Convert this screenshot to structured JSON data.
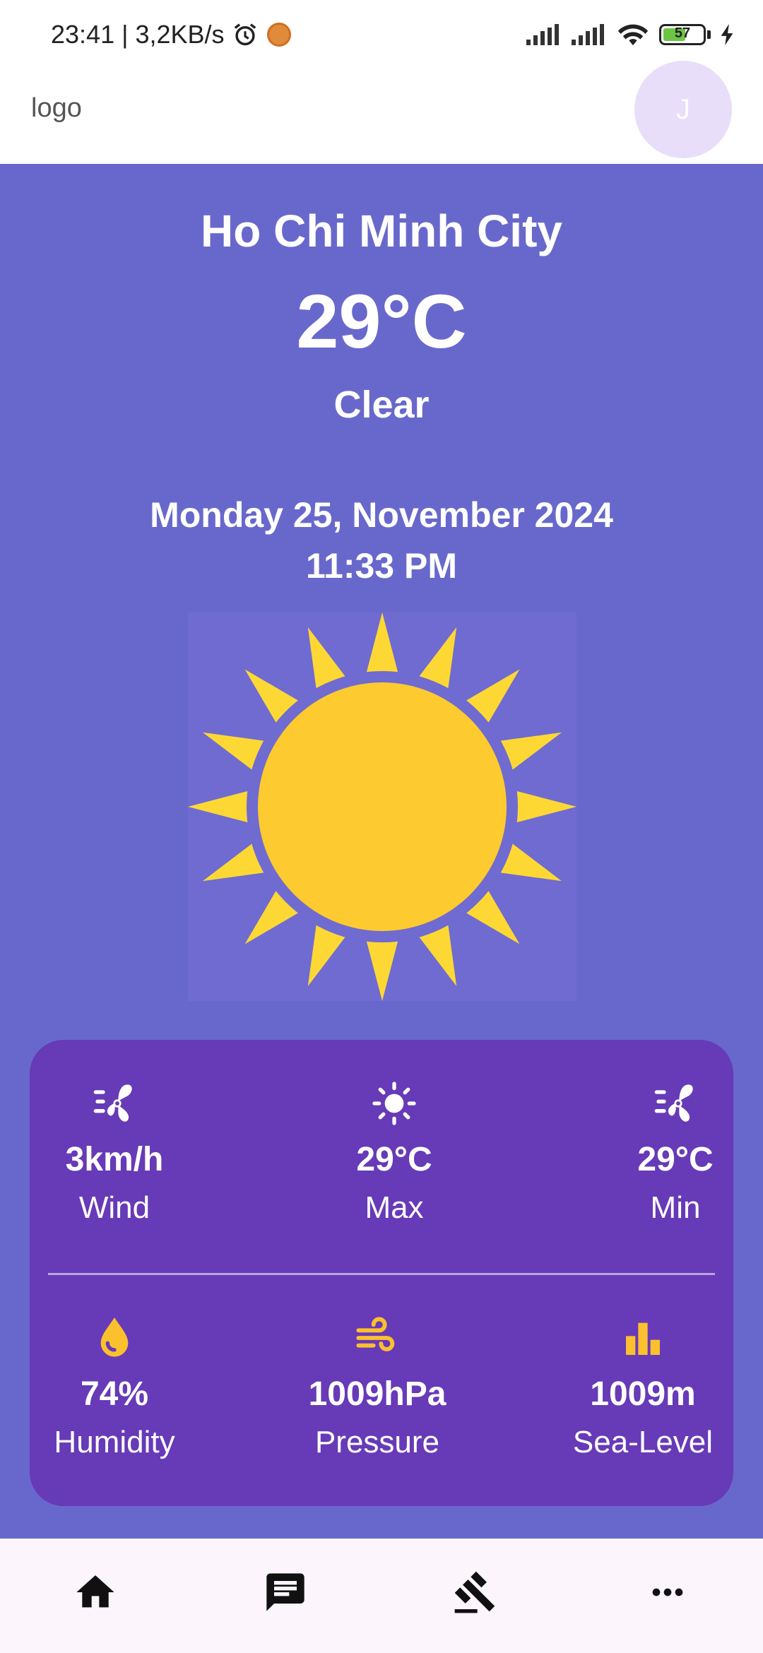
{
  "status_bar": {
    "time_speed": "23:41 | 3,2KB/s",
    "battery": "57",
    "battery_level": 0.57
  },
  "app_bar": {
    "logo": "logo",
    "avatar_initial": "J"
  },
  "weather": {
    "city": "Ho Chi Minh City",
    "temperature": "29°C",
    "condition": "Clear",
    "date": "Monday 25, November 2024",
    "time": "11:33 PM",
    "icon": "sun-icon"
  },
  "details": {
    "wind": {
      "value": "3km/h",
      "label": "Wind",
      "icon": "fan-icon"
    },
    "max": {
      "value": "29°C",
      "label": "Max",
      "icon": "sun-small-icon"
    },
    "min": {
      "value": "29°C",
      "label": "Min",
      "icon": "fan-icon"
    },
    "humidity": {
      "value": "74%",
      "label": "Humidity",
      "icon": "water-drop-icon"
    },
    "pressure": {
      "value": "1009hPa",
      "label": "Pressure",
      "icon": "air-icon"
    },
    "sea_level": {
      "value": "1009m",
      "label": "Sea-Level",
      "icon": "bar-chart-icon"
    }
  },
  "bottom_nav": {
    "items": [
      {
        "icon": "home-icon"
      },
      {
        "icon": "chat-icon"
      },
      {
        "icon": "gavel-icon"
      },
      {
        "icon": "more-icon"
      }
    ]
  },
  "colors": {
    "background": "#6868cc",
    "card": "#673ab7",
    "accent": "#fbc02d",
    "sun": "#fdca2f",
    "sun_rays": "#fdd835"
  }
}
